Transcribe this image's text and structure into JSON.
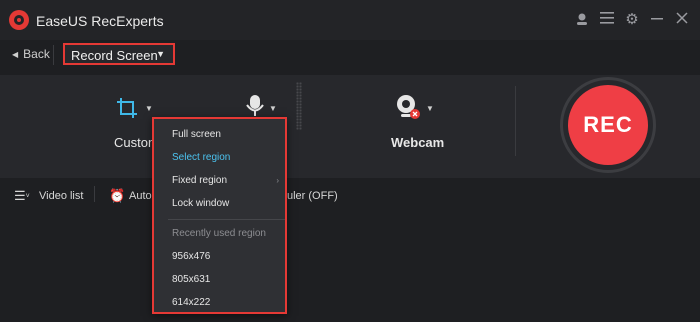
{
  "app": {
    "title": "EaseUS RecExperts"
  },
  "toolbar": {
    "back_label": "Back",
    "mode_label": "Record Screen"
  },
  "options": {
    "custom_label": "Custom",
    "webcam_label": "Webcam"
  },
  "rec_button": {
    "label": "REC"
  },
  "bottom": {
    "video_list_label": "Video list",
    "auto_label": "Auto",
    "scheduler_label": "uler (OFF)"
  },
  "menu": {
    "items": [
      "Full screen",
      "Select region",
      "Fixed region",
      "Lock window"
    ],
    "section_label": "Recently used region",
    "recent": [
      "956x476",
      "805x631",
      "614x222"
    ]
  },
  "colors": {
    "accent": "#e53935",
    "highlight": "#4cc3f0",
    "rec": "#ef3e45"
  }
}
